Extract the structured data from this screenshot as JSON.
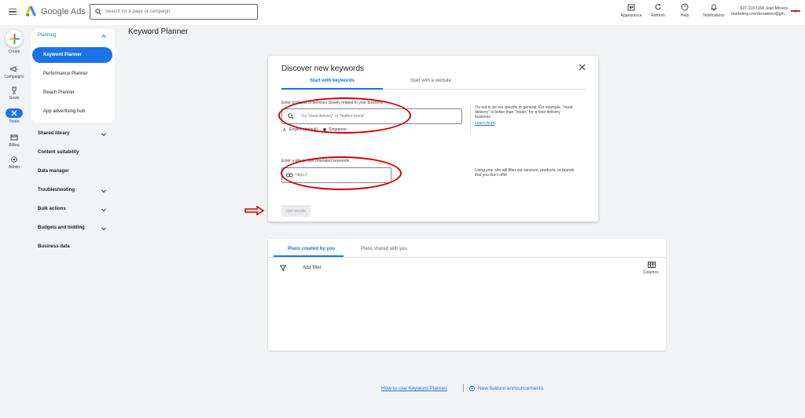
{
  "topbar": {
    "product_name": "Google Ads",
    "search_placeholder": "Search for a page or campaign",
    "tools": [
      {
        "label": "Appearance",
        "icon": "appearance-icon"
      },
      {
        "label": "Refresh",
        "icon": "refresh-icon"
      },
      {
        "label": "Help",
        "icon": "help-icon"
      },
      {
        "label": "Notifications",
        "icon": "bell-icon"
      }
    ],
    "account_line1": "637-110-1168 Jean Movers",
    "account_line2": "marketing.creedcreatives@gm..."
  },
  "rail": {
    "create": "Create",
    "campaigns": "Campaigns",
    "goals": "Goals",
    "tools": "Tools",
    "billing": "Billing",
    "admin": "Admin"
  },
  "nav": {
    "planning": "Planning",
    "keyword_planner": "Keyword Planner",
    "performance_planner": "Performance Planner",
    "reach_planner": "Reach Planner",
    "app_hub": "App advertising hub",
    "shared_library": "Shared library",
    "content_suitability": "Content suitability",
    "data_manager": "Data manager",
    "troubleshooting": "Troubleshooting",
    "bulk_actions": "Bulk actions",
    "budgets_bidding": "Budgets and bidding",
    "business_data": "Business data"
  },
  "page_title": "Keyword Planner",
  "discover": {
    "title": "Discover new keywords",
    "tab_keywords": "Start with keywords",
    "tab_website": "Start with a website",
    "products_label": "Enter products or services closely related to your business",
    "keyword_placeholder": "Try \"meal delivery\" or \"leather boots\"",
    "language": "English (default)",
    "location": "Singapore",
    "hint": "Try not to be too specific or general. For example, \"meal delivery\" is better than \"meals\" for a food delivery business",
    "learn_more": "Learn more",
    "site_label": "Enter a site to filter unrelated keywords",
    "url_placeholder": "https://",
    "site_hint": "Using your site will filter out services, products, or brands that you don't offer",
    "get_results": "Get results"
  },
  "plans": {
    "tab_created": "Plans created by you",
    "tab_shared": "Plans shared with you",
    "add_filter": "Add filter",
    "columns": "Columns"
  },
  "footer": {
    "how_to": "How to use Keyword Planner",
    "new_features": "New feature announcements"
  },
  "colors": {
    "accent": "#1a73e8",
    "annotation": "#d20000",
    "background": "#f1f3f4"
  }
}
